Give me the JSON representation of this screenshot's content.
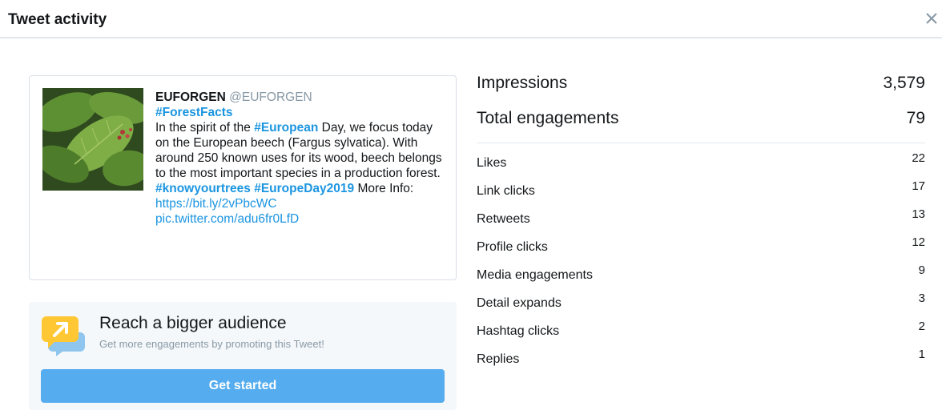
{
  "header": {
    "title": "Tweet activity"
  },
  "tweet": {
    "author_name": "EUFORGEN",
    "author_handle": "@EUFORGEN",
    "hashtag_forestfacts": "#ForestFacts",
    "text_1": "In the spirit of the ",
    "hashtag_european": "#European",
    "text_2": " Day, we focus today on the European beech (Fargus sylvatica). With around 250 known uses for its wood, beech belongs to the most important species in a production forest. ",
    "hashtag_knowyourtrees": "#knowyourtrees",
    "hashtag_europeday": "#EuropeDay2019",
    "text_3": " More Info: ",
    "link_url": "https://bit.ly/2vPbcWC",
    "pic_link": "pic.twitter.com/adu6fr0LfD"
  },
  "promote": {
    "title": "Reach a bigger audience",
    "subtitle": "Get more engagements by promoting this Tweet!",
    "button_label": "Get started"
  },
  "metrics": {
    "impressions_label": "Impressions",
    "impressions_value": "3,579",
    "engagements_label": "Total engagements",
    "engagements_value": "79",
    "items": [
      {
        "label": "Likes",
        "value": "22"
      },
      {
        "label": "Link clicks",
        "value": "17"
      },
      {
        "label": "Retweets",
        "value": "13"
      },
      {
        "label": "Profile clicks",
        "value": "12"
      },
      {
        "label": "Media engagements",
        "value": "9"
      },
      {
        "label": "Detail expands",
        "value": "3"
      },
      {
        "label": "Hashtag clicks",
        "value": "2"
      },
      {
        "label": "Replies",
        "value": "1"
      }
    ]
  },
  "colors": {
    "accent_link": "#1b95e0",
    "button_blue": "#55acee",
    "muted": "#8899a6"
  }
}
